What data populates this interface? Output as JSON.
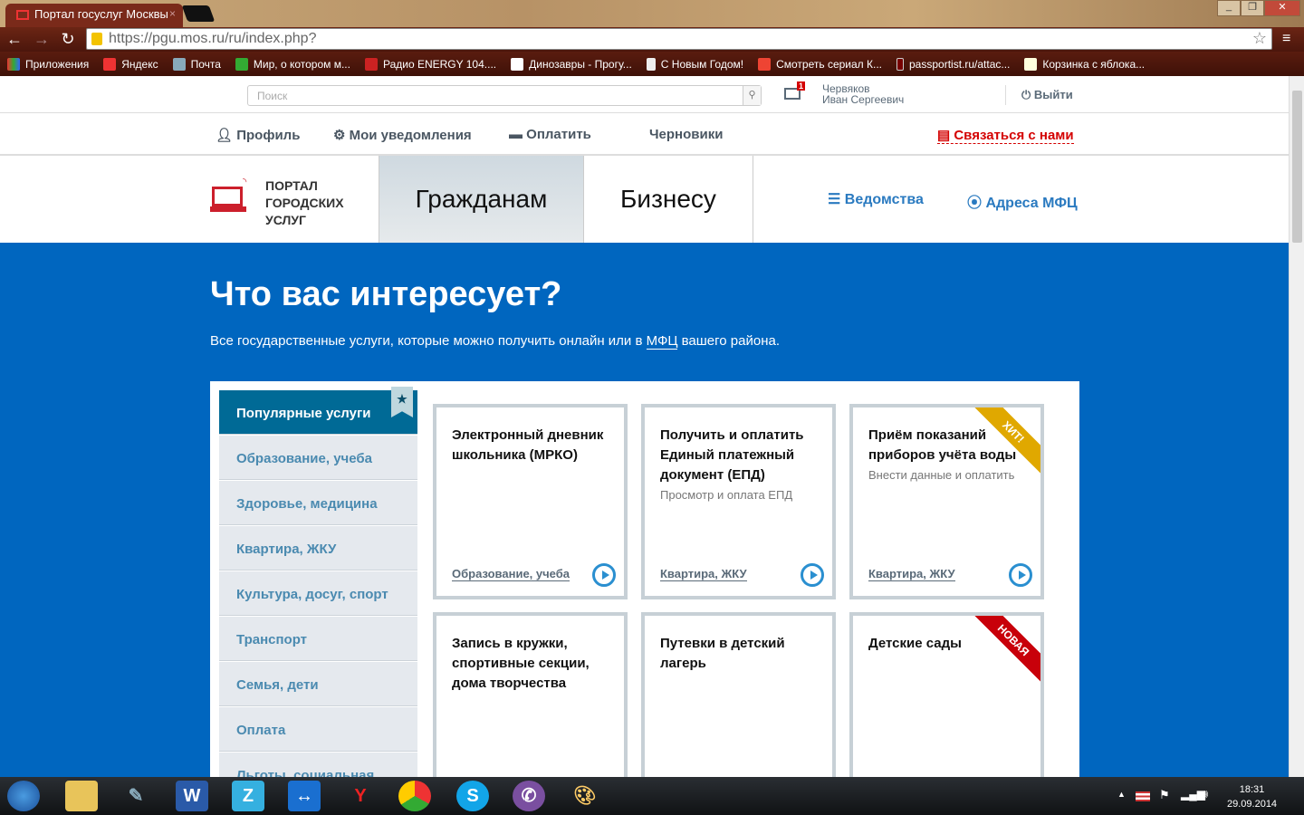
{
  "browser": {
    "tab_title": "Портал госуслуг Москвы",
    "url": "https://pgu.mos.ru/ru/index.php?",
    "bookmarks": [
      "Приложения",
      "Яндекс",
      "Почта",
      "Мир, о котором м...",
      "Радио ENERGY 104....",
      "Динозавры - Прогу...",
      "С Новым Годом!",
      "Смотреть сериал К...",
      "passportist.ru/attac...",
      "Корзинка с яблока..."
    ]
  },
  "topbar": {
    "search_placeholder": "Поиск",
    "mail_count": "1",
    "user_last": "Червяков",
    "user_first": "Иван Сергеевич",
    "logout": "Выйти"
  },
  "nav": {
    "profile": "Профиль",
    "notifications": "Мои уведомления",
    "pay": "Оплатить",
    "drafts": "Черновики",
    "contact": "Связаться с нами"
  },
  "header": {
    "logo_lines": [
      "ПОРТАЛ",
      "ГОРОДСКИХ",
      "УСЛУГ"
    ],
    "tab_citizens": "Гражданам",
    "tab_business": "Бизнесу",
    "departments": "Ведомства",
    "mfc": "Адреса МФЦ"
  },
  "hero": {
    "title": "Что вас интересует?",
    "subtitle_before": "Все государственные услуги, которые можно получить онлайн или в ",
    "subtitle_link": "МФЦ",
    "subtitle_after": " вашего района."
  },
  "categories": [
    "Популярные услуги",
    "Образование, учеба",
    "Здоровье, медицина",
    "Квартира, ЖКУ",
    "Культура, досуг, спорт",
    "Транспорт",
    "Семья, дети",
    "Оплата",
    "Льготы, социальная"
  ],
  "cards": [
    {
      "title": "Электронный дневник школьника (МРКО)",
      "desc": "",
      "category": "Образование, учеба",
      "badge": ""
    },
    {
      "title": "Получить и оплатить Единый платежный документ (ЕПД)",
      "desc": "Просмотр и оплата ЕПД",
      "category": "Квартира, ЖКУ",
      "badge": ""
    },
    {
      "title": "Приём показаний приборов учёта воды",
      "desc": "Внести данные и оплатить",
      "category": "Квартира, ЖКУ",
      "badge": "ХИТ!"
    },
    {
      "title": "Запись в кружки, спортивные секции, дома творчества",
      "desc": "",
      "category": "",
      "badge": ""
    },
    {
      "title": "Путевки в детский лагерь",
      "desc": "",
      "category": "",
      "badge": ""
    },
    {
      "title": "Детские сады",
      "desc": "",
      "category": "",
      "badge": "НОВАЯ"
    }
  ],
  "taskbar": {
    "time": "18:31",
    "date": "29.09.2014"
  }
}
